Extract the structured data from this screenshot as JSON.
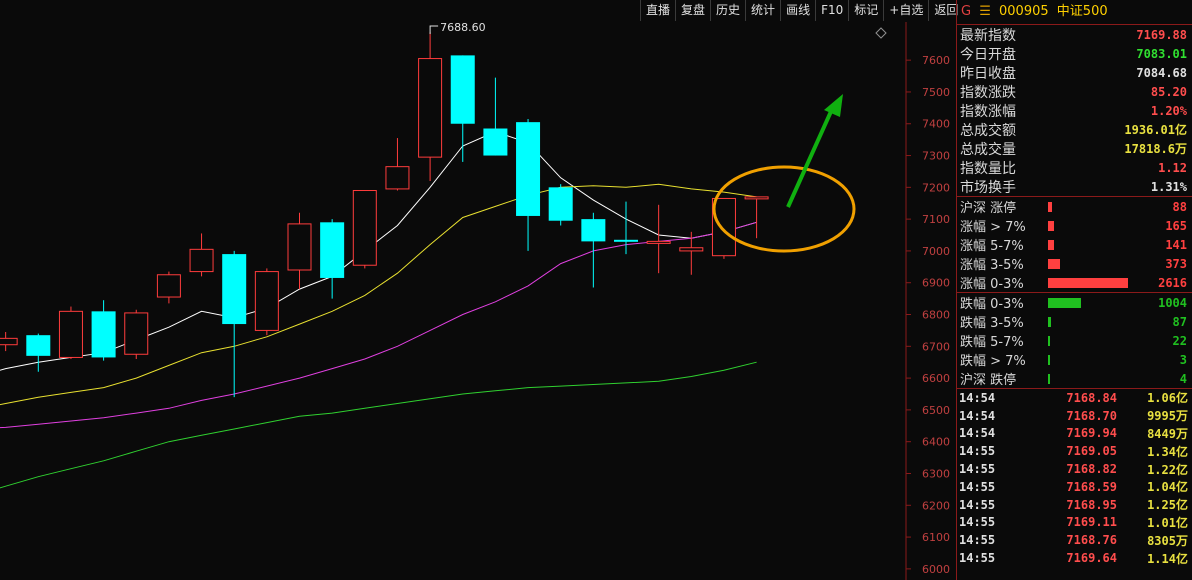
{
  "toolbar": {
    "buttons": [
      "直播",
      "复盘",
      "历史",
      "统计",
      "画线",
      "F10",
      "标记",
      "+自选",
      "返回"
    ]
  },
  "chart_data": {
    "type": "candlestick",
    "y_ticks": [
      7600,
      7500,
      7400,
      7300,
      7200,
      7100,
      7000,
      6900,
      6800,
      6700,
      6600,
      6500,
      6400,
      6300,
      6200,
      6100,
      6000
    ],
    "ylim": [
      5965,
      7720
    ],
    "x_count": 24,
    "high_annotation": "7688.60",
    "high_value": 7688.6,
    "high_index": 14,
    "candles": [
      {
        "o": 6680,
        "h": 6700,
        "l": 6665,
        "c": 6690
      },
      {
        "o": 6705,
        "h": 6745,
        "l": 6685,
        "c": 6725
      },
      {
        "o": 6735,
        "h": 6740,
        "l": 6620,
        "c": 6670
      },
      {
        "o": 6665,
        "h": 6825,
        "l": 6660,
        "c": 6810
      },
      {
        "o": 6810,
        "h": 6845,
        "l": 6655,
        "c": 6665
      },
      {
        "o": 6675,
        "h": 6815,
        "l": 6660,
        "c": 6805
      },
      {
        "o": 6855,
        "h": 6935,
        "l": 6835,
        "c": 6925
      },
      {
        "o": 6935,
        "h": 7055,
        "l": 6920,
        "c": 7005
      },
      {
        "o": 6990,
        "h": 7000,
        "l": 6540,
        "c": 6770
      },
      {
        "o": 6750,
        "h": 6945,
        "l": 6735,
        "c": 6935
      },
      {
        "o": 6940,
        "h": 7120,
        "l": 6880,
        "c": 7085
      },
      {
        "o": 7090,
        "h": 7100,
        "l": 6850,
        "c": 6915
      },
      {
        "o": 6955,
        "h": 7190,
        "l": 6945,
        "c": 7190
      },
      {
        "o": 7195,
        "h": 7355,
        "l": 7190,
        "c": 7265
      },
      {
        "o": 7295,
        "h": 7688.6,
        "l": 7220,
        "c": 7605
      },
      {
        "o": 7615,
        "h": 7610,
        "l": 7280,
        "c": 7400
      },
      {
        "o": 7385,
        "h": 7545,
        "l": 7310,
        "c": 7300
      },
      {
        "o": 7405,
        "h": 7415,
        "l": 7000,
        "c": 7110
      },
      {
        "o": 7200,
        "h": 7210,
        "l": 7080,
        "c": 7095
      },
      {
        "o": 7100,
        "h": 7120,
        "l": 6885,
        "c": 7030
      },
      {
        "o": 7035,
        "h": 7155,
        "l": 6990,
        "c": 7030
      },
      {
        "o": 7025,
        "h": 7145,
        "l": 6930,
        "c": 7030
      },
      {
        "o": 7000,
        "h": 7060,
        "l": 6925,
        "c": 7010
      },
      {
        "o": 6985,
        "h": 7165,
        "l": 6975,
        "c": 7165
      },
      {
        "o": 7165,
        "h": 7170,
        "l": 7040,
        "c": 7170
      }
    ],
    "series": [
      {
        "color": "#ffffff",
        "values": [
          6600,
          6630,
          6650,
          6665,
          6680,
          6720,
          6760,
          6810,
          6790,
          6820,
          6880,
          6920,
          7000,
          7080,
          7200,
          7330,
          7375,
          7340,
          7230,
          7160,
          7100,
          7050,
          7040,
          7060,
          7090
        ]
      },
      {
        "color": "#e8e030",
        "values": [
          6500,
          6520,
          6540,
          6555,
          6570,
          6600,
          6640,
          6680,
          6700,
          6730,
          6770,
          6810,
          6860,
          6930,
          7020,
          7105,
          7140,
          7175,
          7200,
          7205,
          7200,
          7210,
          7195,
          7185,
          7170
        ]
      },
      {
        "color": "#e040e0",
        "values": [
          6440,
          6445,
          6455,
          6465,
          6475,
          6490,
          6505,
          6530,
          6550,
          6575,
          6600,
          6630,
          6660,
          6700,
          6750,
          6800,
          6840,
          6890,
          6960,
          7000,
          7020,
          7030,
          7040,
          7060,
          7090
        ]
      },
      {
        "color": "#30d030",
        "values": [
          6230,
          6260,
          6290,
          6315,
          6340,
          6370,
          6400,
          6420,
          6440,
          6460,
          6480,
          6490,
          6505,
          6520,
          6535,
          6550,
          6560,
          6570,
          6575,
          6580,
          6585,
          6590,
          6605,
          6625,
          6650
        ]
      }
    ]
  },
  "sidebar": {
    "header": {
      "g": "G",
      "menu": "☰",
      "code": "000905",
      "name": "中证500"
    },
    "quote": [
      {
        "label": "最新指数",
        "value": "7169.88",
        "color": "#ff4d4d"
      },
      {
        "label": "今日开盘",
        "value": "7083.01",
        "color": "#30e030"
      },
      {
        "label": "昨日收盘",
        "value": "7084.68",
        "color": "#e0e0e0"
      },
      {
        "label": "指数涨跌",
        "value": "85.20",
        "color": "#ff4d4d"
      },
      {
        "label": "指数涨幅",
        "value": "1.20%",
        "color": "#ff4d4d"
      },
      {
        "label": "总成交额",
        "value": "1936.01亿",
        "color": "#e8e040"
      },
      {
        "label": "总成交量",
        "value": "17818.6万",
        "color": "#e8e040"
      },
      {
        "label": "指数量比",
        "value": "1.12",
        "color": "#ff4d4d"
      },
      {
        "label": "市场换手",
        "value": "1.31%",
        "color": "#e0e0e0"
      }
    ],
    "breadth_up": [
      {
        "label": "沪深 涨停",
        "value": "88",
        "fill": 0.05
      },
      {
        "label": "涨幅 > 7%",
        "value": "165",
        "fill": 0.07
      },
      {
        "label": "涨幅 5-7%",
        "value": "141",
        "fill": 0.07
      },
      {
        "label": "涨幅 3-5%",
        "value": "373",
        "fill": 0.15
      },
      {
        "label": "涨幅 0-3%",
        "value": "2616",
        "fill": 0.98
      }
    ],
    "breadth_down": [
      {
        "label": "跌幅 0-3%",
        "value": "1004",
        "fill": 0.4
      },
      {
        "label": "跌幅 3-5%",
        "value": "87",
        "fill": 0.04
      },
      {
        "label": "跌幅 5-7%",
        "value": "22",
        "fill": 0.015
      },
      {
        "label": "跌幅 > 7%",
        "value": "3",
        "fill": 0.01
      },
      {
        "label": "沪深 跌停",
        "value": "4",
        "fill": 0.01
      }
    ],
    "up_color": "#ff4040",
    "down_color": "#20c020",
    "ticks": [
      {
        "time": "14:54",
        "price": "7168.84",
        "vol": "1.06",
        "unit": "亿"
      },
      {
        "time": "14:54",
        "price": "7168.70",
        "vol": "9995",
        "unit": "万"
      },
      {
        "time": "14:54",
        "price": "7169.94",
        "vol": "8449",
        "unit": "万"
      },
      {
        "time": "14:55",
        "price": "7169.05",
        "vol": "1.34",
        "unit": "亿"
      },
      {
        "time": "14:55",
        "price": "7168.82",
        "vol": "1.22",
        "unit": "亿"
      },
      {
        "time": "14:55",
        "price": "7168.59",
        "vol": "1.04",
        "unit": "亿"
      },
      {
        "time": "14:55",
        "price": "7168.95",
        "vol": "1.25",
        "unit": "亿"
      },
      {
        "time": "14:55",
        "price": "7169.11",
        "vol": "1.01",
        "unit": "亿"
      },
      {
        "time": "14:55",
        "price": "7168.76",
        "vol": "8305",
        "unit": "万"
      },
      {
        "time": "14:55",
        "price": "7169.64",
        "vol": "1.14",
        "unit": "亿"
      }
    ]
  }
}
